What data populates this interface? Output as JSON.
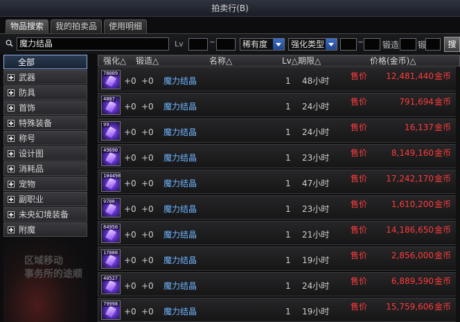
{
  "window": {
    "title": "拍卖行(B)"
  },
  "tabs": [
    {
      "label": "物品搜索",
      "active": true
    },
    {
      "label": "我的拍卖品",
      "active": false
    },
    {
      "label": "使用明细",
      "active": false
    }
  ],
  "search": {
    "query": "魔力结晶",
    "lv_label": "Lv",
    "tilde": "~",
    "rarity": "稀有度",
    "enhance_type": "强化类型",
    "forge_label": "锻造",
    "forge_sep": "锻",
    "button": "搜"
  },
  "sidebar": {
    "items": [
      {
        "label": "全部",
        "selected": true
      },
      {
        "label": "武器"
      },
      {
        "label": "防具"
      },
      {
        "label": "首饰"
      },
      {
        "label": "特殊装备"
      },
      {
        "label": "称号"
      },
      {
        "label": "设计图"
      },
      {
        "label": "消耗品"
      },
      {
        "label": "宠物"
      },
      {
        "label": "副职业"
      },
      {
        "label": "未央幻境装备"
      },
      {
        "label": "附魔"
      }
    ],
    "watermark": [
      "区域移动",
      "事务所的途顺"
    ]
  },
  "columns": {
    "enhance": "强化△",
    "forge": "锻造△",
    "name": "名称△",
    "lv_period": "Lv△期限△",
    "price": "价格(金币)△"
  },
  "rows": [
    {
      "qty": "78009",
      "enhance": "+0",
      "forge": "+0",
      "name": "魔力结晶",
      "lv": "1",
      "period": "48小时",
      "sell": "售价",
      "price": "12,481,440",
      "unit": "金币"
    },
    {
      "qty": "4887",
      "enhance": "+0",
      "forge": "+0",
      "name": "魔力结晶",
      "lv": "1",
      "period": "24小时",
      "sell": "售价",
      "price": "791,694",
      "unit": "金币"
    },
    {
      "qty": "99",
      "enhance": "+0",
      "forge": "+0",
      "name": "魔力结晶",
      "lv": "1",
      "period": "24小时",
      "sell": "售价",
      "price": "16,137",
      "unit": "金币"
    },
    {
      "qty": "49690",
      "enhance": "+0",
      "forge": "+0",
      "name": "魔力结晶",
      "lv": "1",
      "period": "23小时",
      "sell": "售价",
      "price": "8,149,160",
      "unit": "金币"
    },
    {
      "qty": "104498",
      "enhance": "+0",
      "forge": "+0",
      "name": "魔力结晶",
      "lv": "1",
      "period": "47小时",
      "sell": "售价",
      "price": "17,242,170",
      "unit": "金币"
    },
    {
      "qty": "9700",
      "enhance": "+0",
      "forge": "+0",
      "name": "魔力结晶",
      "lv": "1",
      "period": "23小时",
      "sell": "售价",
      "price": "1,610,200",
      "unit": "金币"
    },
    {
      "qty": "84950",
      "enhance": "+0",
      "forge": "+0",
      "name": "魔力结晶",
      "lv": "1",
      "period": "21小时",
      "sell": "售价",
      "price": "14,186,650",
      "unit": "金币"
    },
    {
      "qty": "17000",
      "enhance": "+0",
      "forge": "+0",
      "name": "魔力结晶",
      "lv": "1",
      "period": "19小时",
      "sell": "售价",
      "price": "2,856,000",
      "unit": "金币"
    },
    {
      "qty": "40527",
      "enhance": "+0",
      "forge": "+0",
      "name": "魔力结晶",
      "lv": "1",
      "period": "24小时",
      "sell": "售价",
      "price": "6,889,590",
      "unit": "金币"
    },
    {
      "qty": "79998",
      "enhance": "+0",
      "forge": "+0",
      "name": "魔力结晶",
      "lv": "1",
      "period": "19小时",
      "sell": "售价",
      "price": "15,759,606",
      "unit": "金币"
    }
  ]
}
